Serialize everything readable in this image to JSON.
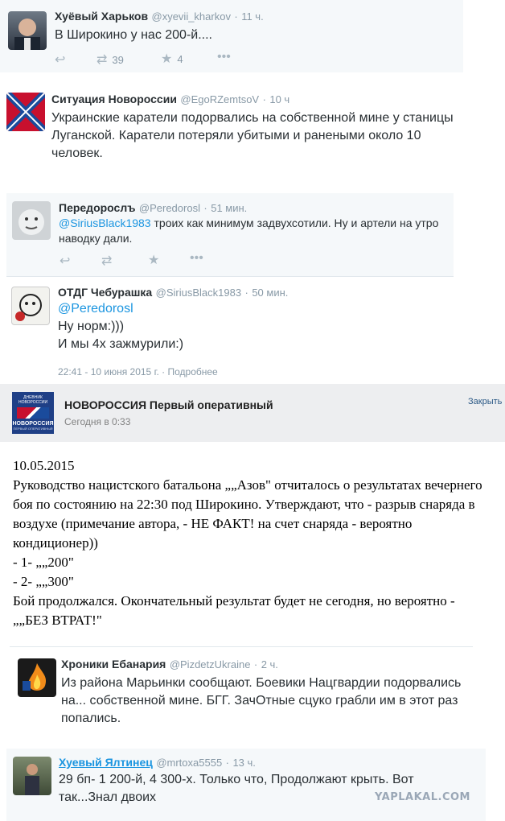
{
  "tweets": [
    {
      "name": "Хуёвый Харьков",
      "handle": "@xyevii_kharkov",
      "time": "11 ч.",
      "lines": [
        "В Широкино у нас 200-й...."
      ],
      "retweets": "39",
      "likes": "4"
    },
    {
      "name": "Ситуация Новороссии",
      "handle": "@EgoRZemtsoV",
      "time": "10 ч",
      "lines": [
        "Украинские каратели подорвались на собственной мине у станицы",
        "Луганской. Каратели потеряли убитыми и ранеными около 10",
        "человек."
      ]
    },
    {
      "name": "Передорослъ",
      "handle": "@Peredorosl",
      "time": "51 мин.",
      "mention": "@SiriusBlack1983",
      "line1_rest": " троих как минимум задвухсотили. Ну и артели на утро",
      "line2": "наводку дали."
    },
    {
      "name": "ОТДГ Чебурашка",
      "handle": "@SiriusBlack1983",
      "time": "50 мин.",
      "mention": "@Peredorosl",
      "lines": [
        "Ну норм:)))",
        "И мы 4х зажмурили:)"
      ],
      "footer_date": "22:41 - 10 июня 2015 г.",
      "footer_more": "Подробнее"
    }
  ],
  "vk_post": {
    "title": "НОВОРОССИЯ Первый оперативный",
    "time": "Сегодня в 0:33",
    "close": "Закрыть",
    "logo_top": "ДНЕВНИК НОВОРОССИИ",
    "logo_main": "НОВОРОССИЯ",
    "logo_sub": "ПЕРВЫЙ ОПЕРАТИВНЫЙ",
    "lines": [
      "10.05.2015",
      "Руководство нацистского батальона „„Азов\" отчиталось о результатах вечернего",
      "боя по состоянию на 22:30 под Широкино. Утверждают, что - разрыв снаряда в",
      "воздухе (примечание автора, - НЕ ФАКТ! на счет снаряда - вероятно",
      "кондиционер))",
      "- 1- „„200\"",
      "- 2- „„300\"",
      "Бой продолжался. Окончательный результат будет не сегодня, но вероятно -",
      "„„БЕЗ ВТРАТ!\""
    ]
  },
  "tweets2": [
    {
      "name": "Хроники Ебанария",
      "handle": "@PizdetzUkraine",
      "time": "2 ч.",
      "lines": [
        "Из района Марьинки сообщают. Боевики Нацгвардии подорвались",
        "на...  собственной мине. БГГ. ЗачОтные сцуко грабли им в этот раз",
        "попались."
      ]
    },
    {
      "name": "Хуевый Ялтинец",
      "handle": "@mrtoxa5555",
      "time": "13 ч.",
      "lines": [
        "29 бп- 1 200-й, 4 300-х. Только что, Продолжают крыть. Вот",
        "так...Знал двоих"
      ]
    }
  ],
  "watermark": "YAPLAKAL.COM",
  "colors": {
    "link": "#1b95e0",
    "muted": "#8899a6",
    "icon": "#aab8c2",
    "card_bg": "#f5f8fa"
  }
}
